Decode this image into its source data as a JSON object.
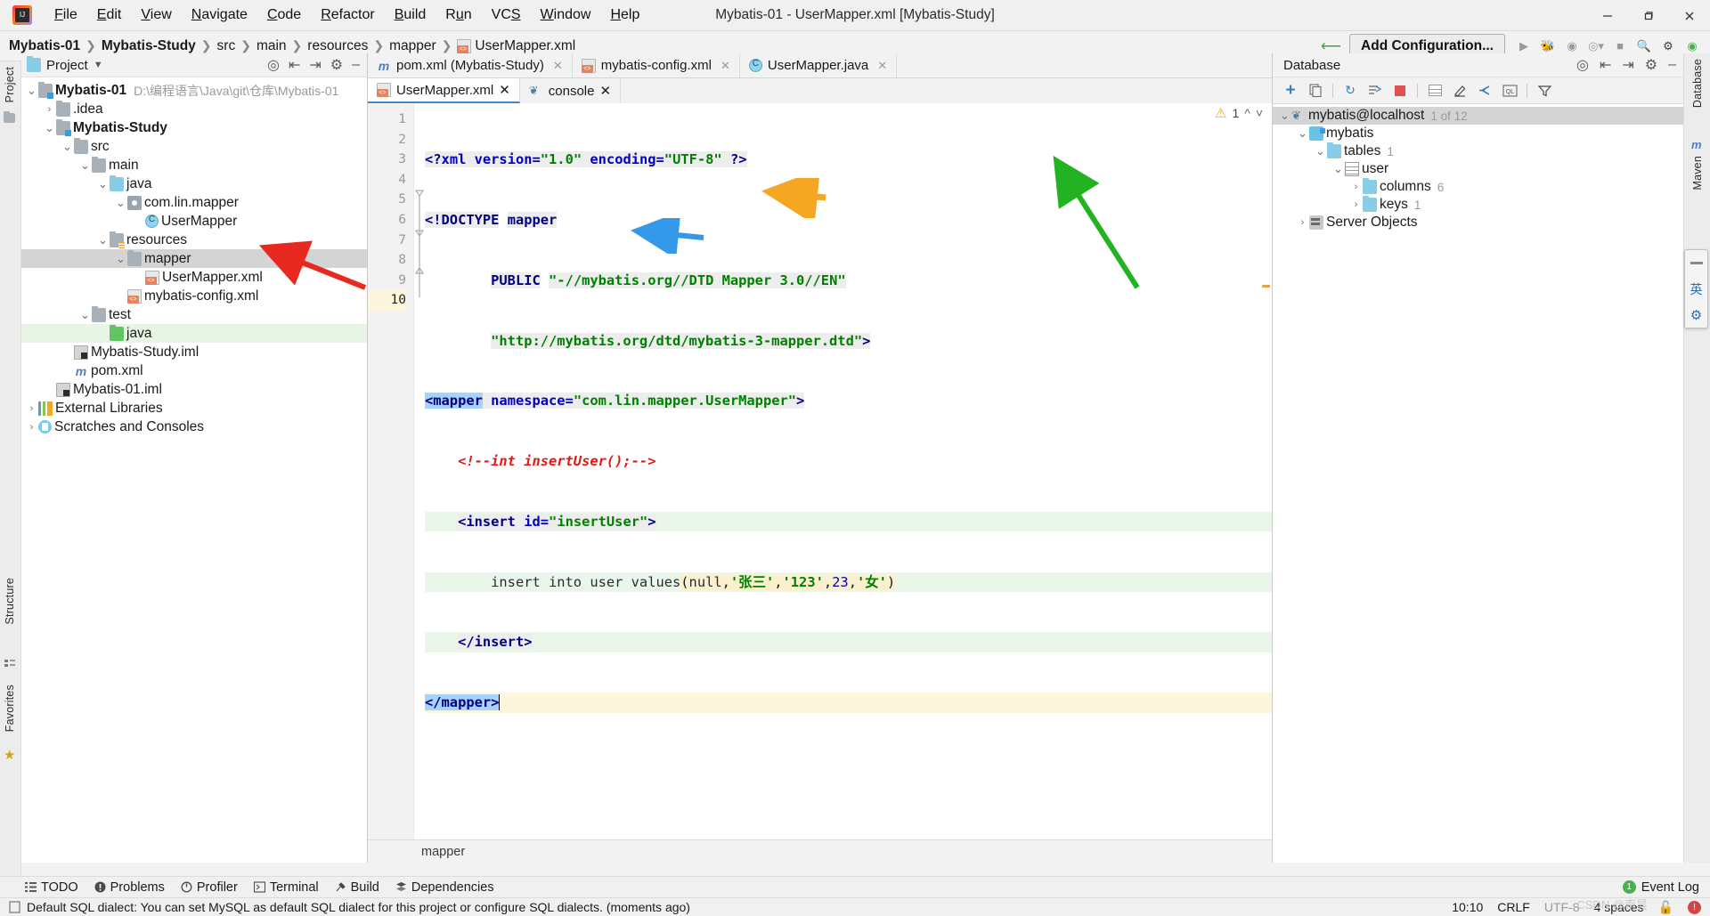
{
  "window": {
    "title": "Mybatis-01 - UserMapper.xml [Mybatis-Study]",
    "minimize": "–",
    "maximize": "❐",
    "close": "✕"
  },
  "menubar": [
    {
      "label": "File",
      "mnemonic": "F"
    },
    {
      "label": "Edit",
      "mnemonic": "E"
    },
    {
      "label": "View",
      "mnemonic": "V"
    },
    {
      "label": "Navigate",
      "mnemonic": "N"
    },
    {
      "label": "Code",
      "mnemonic": "C"
    },
    {
      "label": "Refactor",
      "mnemonic": "R"
    },
    {
      "label": "Build",
      "mnemonic": "B"
    },
    {
      "label": "Run",
      "mnemonic": "R"
    },
    {
      "label": "VCS",
      "mnemonic": "S"
    },
    {
      "label": "Window",
      "mnemonic": "W"
    },
    {
      "label": "Help",
      "mnemonic": "H"
    }
  ],
  "breadcrumb": {
    "items": [
      "Mybatis-01",
      "Mybatis-Study",
      "src",
      "main",
      "resources",
      "mapper",
      "UserMapper.xml"
    ],
    "separator": "❯"
  },
  "toolbar": {
    "add_configuration": "Add Configuration...",
    "run_icon": "run-icon",
    "debug_icon": "debug-icon",
    "coverage_icon": "coverage-icon",
    "profile_icon": "profile-icon",
    "stop_icon": "stop-icon",
    "search_icon": "search-icon",
    "settings_icon": "settings-icon",
    "updates_icon": "updates-icon",
    "hammer_icon": "build-hammer-icon"
  },
  "left_strip": {
    "project_label": "Project",
    "structure_label": "Structure",
    "favorites_label": "Favorites"
  },
  "right_strip": {
    "database_label": "Database",
    "maven_label": "Maven"
  },
  "project_panel": {
    "title": "Project",
    "dropdown": "▾",
    "icons": [
      "locate-icon",
      "collapse-all-icon",
      "expand-all-icon",
      "settings-icon",
      "hide-icon"
    ],
    "tree": [
      {
        "label": "Mybatis-01",
        "path": "D:\\编程语言\\Java\\git\\仓库\\Mybatis-01",
        "indent": 0,
        "arrow": "down",
        "icon": "folder-mod",
        "bold": true,
        "state": "normal"
      },
      {
        "label": ".idea",
        "path": "",
        "indent": 1,
        "arrow": "right",
        "icon": "folder",
        "bold": false,
        "state": "normal"
      },
      {
        "label": "Mybatis-Study",
        "path": "",
        "indent": 1,
        "arrow": "down",
        "icon": "folder-mod",
        "bold": true,
        "state": "normal"
      },
      {
        "label": "src",
        "path": "",
        "indent": 2,
        "arrow": "down",
        "icon": "folder",
        "bold": false,
        "state": "normal"
      },
      {
        "label": "main",
        "path": "",
        "indent": 3,
        "arrow": "down",
        "icon": "folder",
        "bold": false,
        "state": "normal"
      },
      {
        "label": "java",
        "path": "",
        "indent": 4,
        "arrow": "down",
        "icon": "folder-blue",
        "bold": false,
        "state": "normal"
      },
      {
        "label": "com.lin.mapper",
        "path": "",
        "indent": 5,
        "arrow": "down",
        "icon": "package",
        "bold": false,
        "state": "normal"
      },
      {
        "label": "UserMapper",
        "path": "",
        "indent": 6,
        "arrow": "none",
        "icon": "java-class",
        "bold": false,
        "state": "normal"
      },
      {
        "label": "resources",
        "path": "",
        "indent": 4,
        "arrow": "down",
        "icon": "folder-res",
        "bold": false,
        "state": "normal"
      },
      {
        "label": "mapper",
        "path": "",
        "indent": 5,
        "arrow": "down",
        "icon": "folder",
        "bold": false,
        "state": "selected"
      },
      {
        "label": "UserMapper.xml",
        "path": "",
        "indent": 6,
        "arrow": "none",
        "icon": "xml-file",
        "bold": false,
        "state": "normal"
      },
      {
        "label": "mybatis-config.xml",
        "path": "",
        "indent": 5,
        "arrow": "none",
        "icon": "xml-file",
        "bold": false,
        "state": "normal"
      },
      {
        "label": "test",
        "path": "",
        "indent": 3,
        "arrow": "down",
        "icon": "folder",
        "bold": false,
        "state": "normal"
      },
      {
        "label": "java",
        "path": "",
        "indent": 4,
        "arrow": "none",
        "icon": "folder-green",
        "bold": false,
        "state": "green"
      },
      {
        "label": "Mybatis-Study.iml",
        "path": "",
        "indent": 2,
        "arrow": "none",
        "icon": "iml-file",
        "bold": false,
        "state": "normal"
      },
      {
        "label": "pom.xml",
        "path": "",
        "indent": 2,
        "arrow": "none",
        "icon": "maven-file",
        "bold": false,
        "state": "normal"
      },
      {
        "label": "Mybatis-01.iml",
        "path": "",
        "indent": 1,
        "arrow": "none",
        "icon": "iml-file",
        "bold": false,
        "state": "normal"
      },
      {
        "label": "External Libraries",
        "path": "",
        "indent": 0,
        "arrow": "right",
        "icon": "library",
        "bold": false,
        "state": "normal"
      },
      {
        "label": "Scratches and Consoles",
        "path": "",
        "indent": 0,
        "arrow": "right",
        "icon": "scratch",
        "bold": false,
        "state": "normal"
      }
    ]
  },
  "editor": {
    "file_tabs": [
      {
        "label": "pom.xml (Mybatis-Study)",
        "icon": "maven-file",
        "active": false,
        "closable": true
      },
      {
        "label": "mybatis-config.xml",
        "icon": "xml-file",
        "active": false,
        "closable": true
      },
      {
        "label": "UserMapper.java",
        "icon": "java-class",
        "active": false,
        "closable": true
      }
    ],
    "sub_tabs": [
      {
        "label": "UserMapper.xml",
        "icon": "xml-file",
        "active": true,
        "closable": true
      },
      {
        "label": "console",
        "icon": "console-icon",
        "active": false,
        "closable": true
      }
    ],
    "warning_count": "1",
    "warning_up": "⌃",
    "warning_down": "⌄",
    "breadcrumb_bottom": "mapper",
    "lines": [
      {
        "n": "1",
        "text": "<?xml version=\"1.0\" encoding=\"UTF-8\" ?>"
      },
      {
        "n": "2",
        "text": "<!DOCTYPE mapper"
      },
      {
        "n": "3",
        "text": "        PUBLIC \"-//mybatis.org//DTD Mapper 3.0//EN\""
      },
      {
        "n": "4",
        "text": "        \"http://mybatis.org/dtd/mybatis-3-mapper.dtd\">"
      },
      {
        "n": "5",
        "text": "<mapper namespace=\"com.lin.mapper.UserMapper\">"
      },
      {
        "n": "6",
        "text": "    <!--int insertUser();-->"
      },
      {
        "n": "7",
        "text": "    <insert id=\"insertUser\">"
      },
      {
        "n": "8",
        "text": "        insert into user values(null,'张三','123',23,'女')"
      },
      {
        "n": "9",
        "text": "    </insert>"
      },
      {
        "n": "10",
        "text": "</mapper>"
      }
    ]
  },
  "database_panel": {
    "title": "Database",
    "header_icons": [
      "locate-icon",
      "collapse-all-icon",
      "expand-all-icon",
      "settings-icon",
      "hide-icon"
    ],
    "toolbar_icons": [
      "add-icon",
      "duplicate-icon",
      "refresh-icon",
      "sync-icon",
      "stop-icon",
      "table-icon",
      "edit-icon",
      "jump-to-icon",
      "query-console-icon",
      "filter-icon"
    ],
    "tree": [
      {
        "label": "mybatis@localhost",
        "badge": "1 of 12",
        "indent": 0,
        "arrow": "down",
        "icon": "mysql-dolphin-icon",
        "state": "selected"
      },
      {
        "label": "mybatis",
        "badge": "",
        "indent": 1,
        "arrow": "down",
        "icon": "db-schema-icon",
        "state": "normal"
      },
      {
        "label": "tables",
        "badge": "1",
        "indent": 2,
        "arrow": "down",
        "icon": "folder-blue",
        "state": "normal"
      },
      {
        "label": "user",
        "badge": "",
        "indent": 3,
        "arrow": "down",
        "icon": "db-table-icon",
        "state": "normal"
      },
      {
        "label": "columns",
        "badge": "6",
        "indent": 4,
        "arrow": "right",
        "icon": "folder-blue",
        "state": "normal"
      },
      {
        "label": "keys",
        "badge": "1",
        "indent": 4,
        "arrow": "right",
        "icon": "folder-blue",
        "state": "normal"
      },
      {
        "label": "Server Objects",
        "badge": "",
        "indent": 1,
        "arrow": "right",
        "icon": "server-objects-icon",
        "state": "normal"
      }
    ]
  },
  "float_panel": {
    "items": [
      "minimize-icon",
      "ime-chinese-icon",
      "ime-settings-icon"
    ],
    "ime_label": "英"
  },
  "bottom_bar": {
    "items": [
      {
        "label": "TODO",
        "icon": "todo-icon"
      },
      {
        "label": "Problems",
        "icon": "problems-icon"
      },
      {
        "label": "Profiler",
        "icon": "profiler-icon"
      },
      {
        "label": "Terminal",
        "icon": "terminal-icon"
      },
      {
        "label": "Build",
        "icon": "build-icon"
      },
      {
        "label": "Dependencies",
        "icon": "dependencies-icon"
      }
    ],
    "event_log": "Event Log",
    "event_log_count": "1"
  },
  "statusbar": {
    "message": "Default SQL dialect: You can set MySQL as default SQL dialect for this project or configure SQL dialects. (moments ago)",
    "message_icon": "notification-icon",
    "position": "10:10",
    "line_separator": "CRLF",
    "encoding": "UTF-8",
    "indent": "4 spaces",
    "lock_icon": "unlocked-icon",
    "error_icon": "inspection-error-icon",
    "watermark": "CSDN @南昙"
  },
  "annotations": {
    "red_arrow": "red-arrow-pointing-to-mapper-folder",
    "orange_arrow": "orange-arrow-pointing-to-mapper-namespace",
    "blue_arrow": "blue-arrow-pointing-to-insert-tag",
    "green_arrow": "green-arrow-pointing-to-user-table"
  },
  "colors": {
    "accent_blue": "#4386c8",
    "red_arrow": "#e8291f",
    "orange_arrow": "#f5a623",
    "blue_arrow": "#3399e8",
    "green_arrow": "#22b222"
  }
}
